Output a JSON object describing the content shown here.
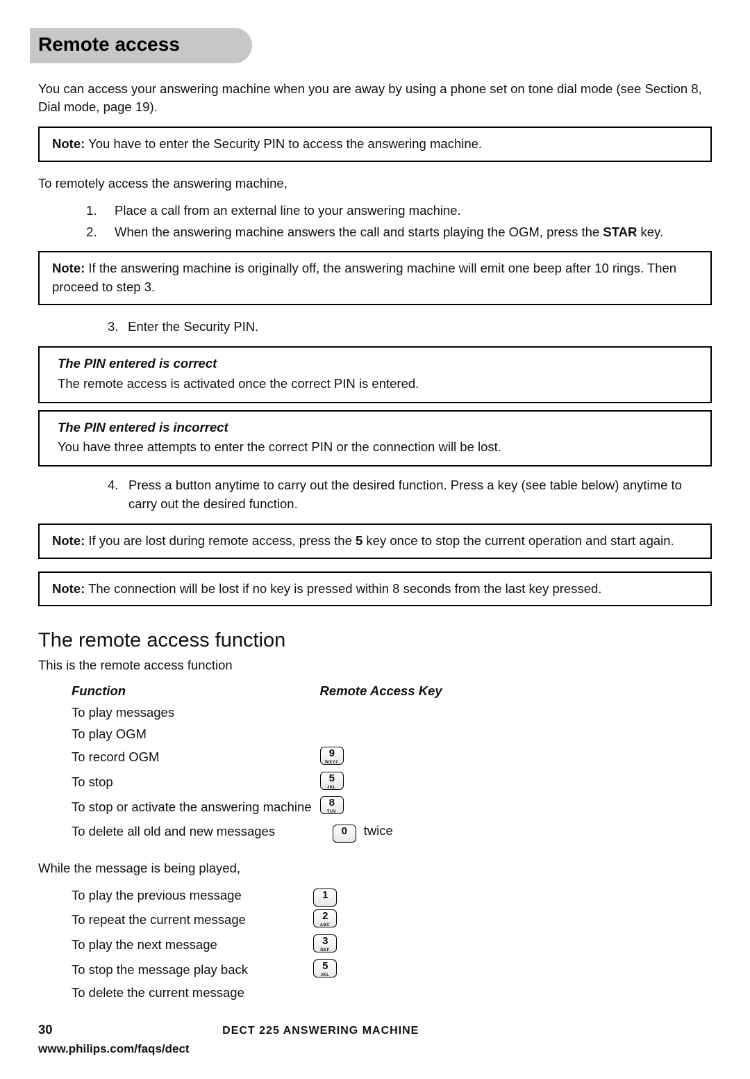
{
  "section_title": "Remote access",
  "intro": "You can access your answering machine when you are away by using a phone set on tone dial mode (see Section 8, Dial mode, page 19).",
  "note1_lead": "Note:",
  "note1_text": "  You have to enter the Security PIN to access the answering machine.",
  "remote_access_lead": "To remotely access the answering machine,",
  "steps_a": {
    "s1": "Place a call from an external line to your answering machine.",
    "s2_a": "When the answering machine answers the call and starts playing the OGM, press the ",
    "s2_b": "STAR",
    "s2_c": " key."
  },
  "note2_lead": "Note:",
  "note2_text": "  If the answering machine is originally off, the answering machine will emit one beep after 10 rings.  Then proceed to step 3.",
  "step3_num": "3.",
  "step3_text": "Enter the Security PIN.",
  "case_correct_title": "The PIN entered is correct",
  "case_correct_text": "The remote access is activated once the correct PIN is entered.",
  "case_incorrect_title": "The PIN entered is incorrect",
  "case_incorrect_text": "You have three attempts to enter the correct PIN or the connection will be lost.",
  "step4_num": "4.",
  "step4_text": "Press a button anytime to carry out the desired function.  Press a key (see table below) anytime to carry out the desired function.",
  "note3_lead": "Note:",
  "note3_a": "  If you are lost during remote access, press the ",
  "note3_b": "5",
  "note3_c": " key once to stop the current operation and start again.",
  "note4_lead": "Note:",
  "note4_text": "  The connection will be lost if no key is pressed within 8 seconds from the last key pressed.",
  "h2": "The remote access function",
  "h2_sub": "This is the remote access function",
  "table1": {
    "head_func": "Function",
    "head_key": "Remote Access Key",
    "rows": [
      {
        "func": "To play messages",
        "key": {
          "big": "",
          "sub": ""
        },
        "after": ""
      },
      {
        "func": "To play OGM",
        "key": {
          "big": "",
          "sub": ""
        },
        "after": ""
      },
      {
        "func": "To record OGM",
        "key": {
          "big": "9",
          "sub": "WXYZ"
        },
        "after": ""
      },
      {
        "func": "To stop",
        "key": {
          "big": "5",
          "sub": "JKL"
        },
        "after": ""
      },
      {
        "func": "To stop or activate the answering machine",
        "key": {
          "big": "8",
          "sub": "TUV"
        },
        "after": ""
      },
      {
        "func": "To delete all old and new messages",
        "key": {
          "big": "0",
          "sub": ""
        },
        "after": "twice"
      }
    ]
  },
  "while_playing": "While the message is being played,",
  "table2": {
    "rows": [
      {
        "func": "To play the previous message",
        "key": {
          "big": "1",
          "sub": ""
        }
      },
      {
        "func": "To repeat the current message",
        "key": {
          "big": "2",
          "sub": "ABC"
        }
      },
      {
        "func": "To play the next message",
        "key": {
          "big": "3",
          "sub": "DEF"
        }
      },
      {
        "func": "To stop the message play back",
        "key": {
          "big": "5",
          "sub": "JKL"
        }
      },
      {
        "func": "To delete the current message",
        "key": {
          "big": "",
          "sub": ""
        }
      }
    ]
  },
  "footer": {
    "page": "30",
    "machine": "DECT 225 ANSWERING MACHINE",
    "url": "www.philips.com/faqs/dect"
  }
}
